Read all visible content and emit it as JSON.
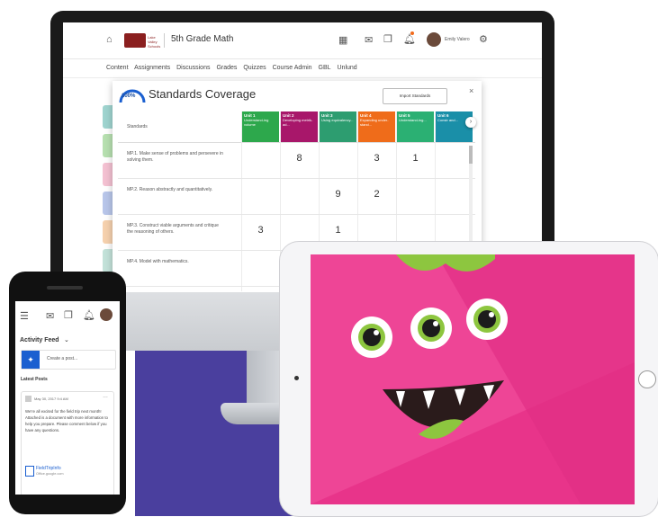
{
  "desktop": {
    "course_title": "5th Grade Math",
    "org_name": "Lake Valley Schools",
    "user_name": "Emily Valero",
    "nav": [
      "Content",
      "Assignments",
      "Discussions",
      "Grades",
      "Quizzes",
      "Course Admin",
      "GBL",
      "Unlund"
    ],
    "modal": {
      "gauge_label": "100%",
      "title": "Standards Coverage",
      "import_button": "Import Standards",
      "close": "×",
      "column_header": "Standards",
      "units": [
        {
          "label": "Unit 1",
          "sub": "Understand-ing volume",
          "color": "#2da84c"
        },
        {
          "label": "Unit 2",
          "sub": "Developing metrik-ad...",
          "color": "#a8176a"
        },
        {
          "label": "Unit 3",
          "sub": "Using equivalency...",
          "color": "#2d9d70"
        },
        {
          "label": "Unit 4",
          "sub": "Expanding under-stand...",
          "color": "#ef6c1a"
        },
        {
          "label": "Unit 5",
          "sub": "Understand-ing...",
          "color": "#2bb073"
        },
        {
          "label": "Unit 6",
          "sub": "Constr and...",
          "color": "#1a8fa8"
        }
      ],
      "rows": [
        {
          "standard": "MP.1. Make sense of problems and persevere in solving them.",
          "values": [
            "",
            "8",
            "",
            "3",
            "1",
            ""
          ]
        },
        {
          "standard": "MP.2. Reason abstractly and quantitatively.",
          "values": [
            "",
            "",
            "9",
            "2",
            "",
            ""
          ]
        },
        {
          "standard": "MP.3. Construct viable arguments and critique the reasoning of others.",
          "values": [
            "3",
            "",
            "1",
            "",
            "",
            ""
          ]
        },
        {
          "standard": "MP.4. Model with mathematics.",
          "values": [
            "",
            "",
            "",
            "",
            "",
            ""
          ]
        }
      ]
    },
    "tile_colors": [
      "#9fd4cf",
      "#b7e0b0",
      "#f4c1d2",
      "#b8c6ea",
      "#f6d1ae",
      "#c3e2d9",
      "#a9d8f0"
    ]
  },
  "phone": {
    "feed_title": "Activity Feed",
    "create_post": "Create a post...",
    "latest_posts": "Latest Posts",
    "post_date": "May 30, 2017 9:4 AM",
    "post_text": "We're all excited for the field trip next month! Attached is a document with more information to help you prepare. Please comment below if you have any questions.",
    "attachment_name": "FieldTripInfo",
    "attachment_meta": "Office.google.com"
  },
  "colors": {
    "brand_blue": "#1a5fd0",
    "monster_pink": "#e8348a",
    "purple_accent": "#4a3f9e"
  }
}
